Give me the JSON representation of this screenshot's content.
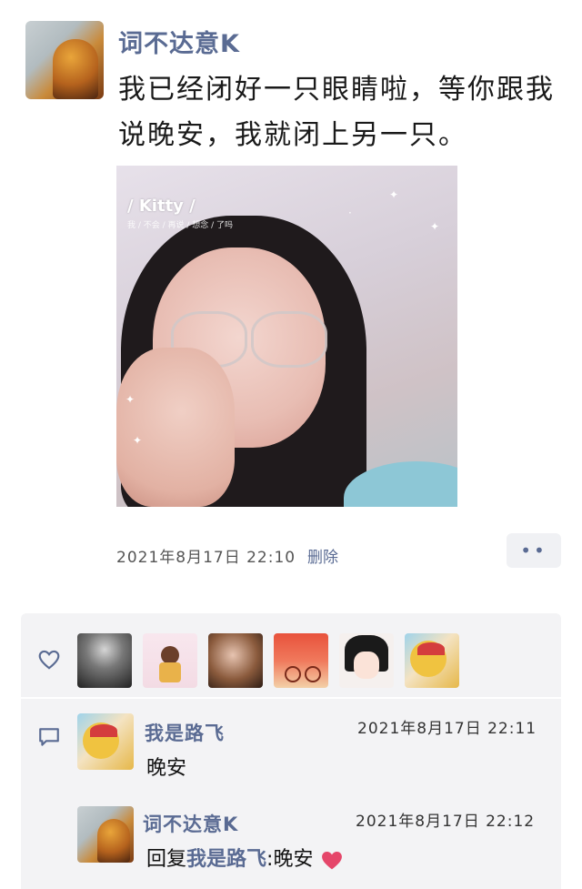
{
  "post": {
    "author": "词不达意K",
    "text": "我已经闭好一只眼睛啦，等你跟我说晚安，我就闭上另一只。",
    "photo": {
      "watermark": "/ Kitty /",
      "watermark_sub": "我 / 不会 / 再说 / 想念 / 了吗"
    },
    "timestamp": "2021年8月17日 22:10",
    "delete_label": "删除",
    "more_label": "••"
  },
  "likes": {
    "avatars": [
      "dark-silhouette-avatar",
      "girl-cartoon-avatar",
      "girl-photo-avatar",
      "bike-illustration-avatar",
      "anime-girl-avatar",
      "cartoon-character-avatar"
    ]
  },
  "comments": [
    {
      "name": "我是路飞",
      "time": "2021年8月17日 22:11",
      "text": "晚安"
    },
    {
      "name": "词不达意K",
      "time": "2021年8月17日 22:12",
      "reply_prefix": "回复",
      "reply_to": "我是路飞",
      "reply_sep": ":",
      "text": "晚安"
    }
  ],
  "colors": {
    "accent": "#5a6b93",
    "panel": "#f3f3f5",
    "heart": "#e5466a"
  }
}
